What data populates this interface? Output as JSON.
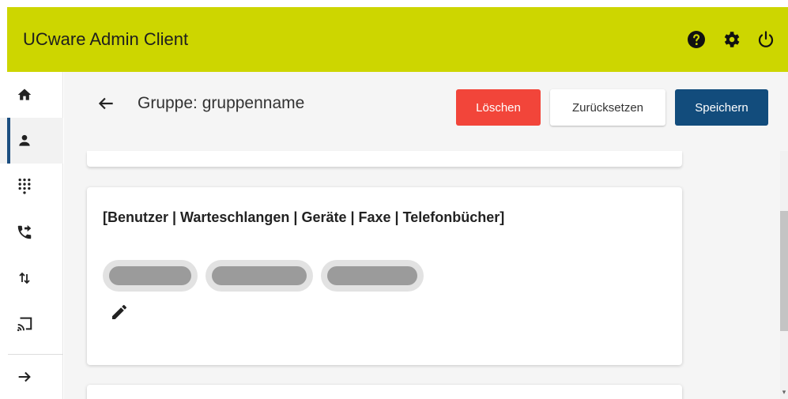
{
  "app": {
    "title": "UCware Admin Client"
  },
  "header_icons": [
    "help-icon",
    "settings-icon",
    "power-icon"
  ],
  "sidebar": {
    "items": [
      {
        "name": "home",
        "icon": "home-icon",
        "active": false
      },
      {
        "name": "users",
        "icon": "person-icon",
        "active": true
      },
      {
        "name": "dialpad",
        "icon": "dialpad-icon",
        "active": false
      },
      {
        "name": "call-forward",
        "icon": "phone-forward-icon",
        "active": false
      },
      {
        "name": "sort",
        "icon": "sort-arrows-icon",
        "active": false
      },
      {
        "name": "cast",
        "icon": "cast-icon",
        "active": false
      }
    ],
    "expand_icon": "arrow-right-icon"
  },
  "page": {
    "title": "Gruppe: gruppenname",
    "buttons": {
      "delete": "Löschen",
      "reset": "Zurücksetzen",
      "save": "Speichern"
    }
  },
  "card": {
    "title": "[Benutzer | Warteschlangen | Geräte | Faxe | Telefonbücher]",
    "chips": 3,
    "edit_icon": "pencil-icon"
  },
  "colors": {
    "header_bg": "#cdd600",
    "delete": "#f2453a",
    "save": "#124c7c",
    "active_indicator": "#1c4e80"
  }
}
